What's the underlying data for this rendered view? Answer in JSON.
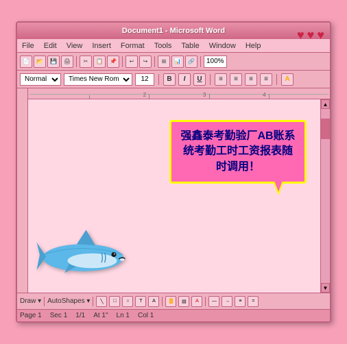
{
  "window": {
    "title": "Document1 - Microsoft Word",
    "hearts": [
      "♥",
      "♥",
      "♥"
    ]
  },
  "menu": {
    "items": [
      "File",
      "Edit",
      "View",
      "Insert",
      "Format",
      "Tools",
      "Table",
      "Window",
      "Help"
    ]
  },
  "toolbar": {
    "buttons": [
      "📄",
      "📂",
      "💾",
      "🖨",
      "🔍",
      "✂",
      "📋",
      "📌",
      "↩",
      "↪",
      "📊",
      "📈",
      "🔗",
      "🖼",
      "100%"
    ]
  },
  "format_bar": {
    "style": "Normal",
    "font": "Times New Roman",
    "size": "12",
    "bold": "B",
    "italic": "I",
    "underline": "U",
    "align_left": "≡",
    "align_center": "≡",
    "align_right": "≡",
    "justify": "≡",
    "percent": "100%"
  },
  "bubble": {
    "text": "强鑫泰考勤验厂AB账系统考勤工时工资报表随时调用！"
  },
  "status_bar": {
    "page": "Page 1",
    "sec": "Sec 1",
    "pages": "1/1",
    "at": "At 1\"",
    "ln": "Ln 1",
    "col": "Col 1"
  },
  "drawing_bar": {
    "draw_label": "Draw ▾",
    "autoshapes_label": "AutoShapes ▾"
  }
}
